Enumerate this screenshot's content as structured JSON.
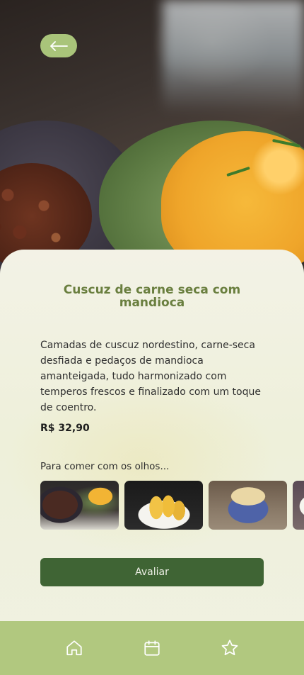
{
  "header": {
    "back_icon": "arrow-left-icon"
  },
  "dish": {
    "title": "Cuscuz de carne seca com mandioca",
    "description": "Camadas de cuscuz nordestino, carne-seca desfiada e pedaços de mandioca amanteigada, tudo harmonizado com temperos frescos e finalizado com um toque de coentro.",
    "price": "R$ 32,90"
  },
  "gallery": {
    "title": "Para comer com os olhos...",
    "photos": [
      "cuscuz-com-carne-seca",
      "mandioca-cozida",
      "cuscuz-em-tigela-azul",
      "prato-parcial"
    ]
  },
  "actions": {
    "rate_label": "Avaliar"
  },
  "bottom_nav": {
    "items": [
      {
        "icon": "home-icon"
      },
      {
        "icon": "calendar-icon"
      },
      {
        "icon": "star-icon"
      }
    ]
  },
  "colors": {
    "accent_green": "#a9c47a",
    "title_green": "#6a7f3f",
    "button_green": "#3f6434",
    "nav_background": "#b1c87f"
  }
}
